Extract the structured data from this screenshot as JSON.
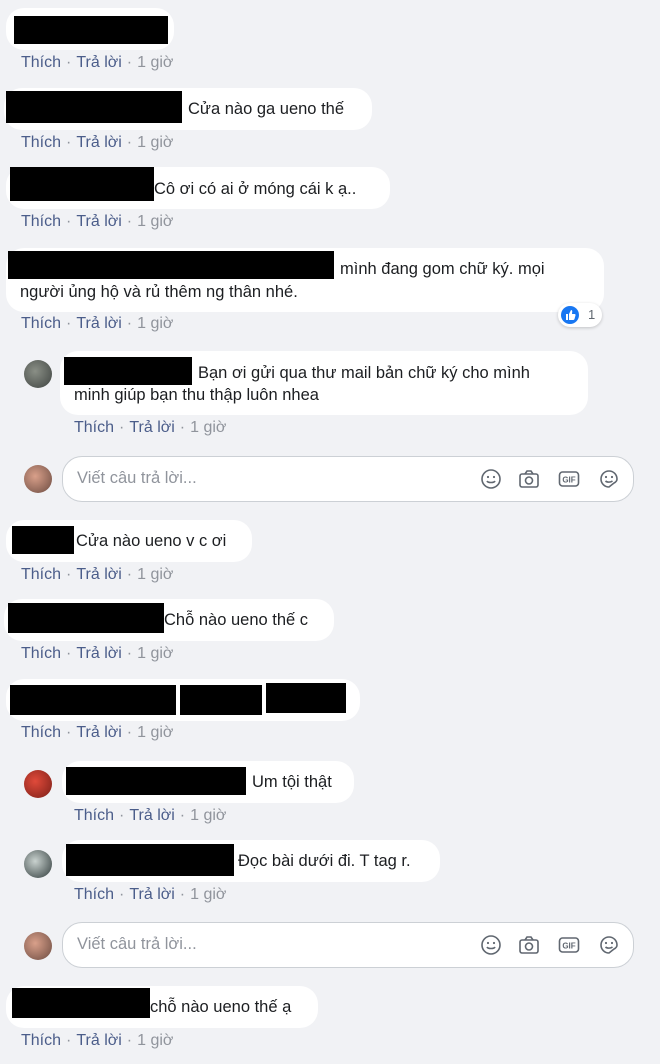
{
  "comments": [
    {
      "text": "",
      "actions": {
        "like": "Thích",
        "reply": "Trả lời",
        "time": "1 giờ"
      }
    },
    {
      "text": "Cửa nào ga ueno thế",
      "actions": {
        "like": "Thích",
        "reply": "Trả lời",
        "time": "1 giờ"
      }
    },
    {
      "text": "Cô ơi có ai ở móng cái k ạ..",
      "actions": {
        "like": "Thích",
        "reply": "Trả lời",
        "time": "1 giờ"
      }
    },
    {
      "text_line1": "mình đang gom chữ ký. mọi",
      "text_line2": "người ủng hộ và rủ thêm ng thân nhé.",
      "reaction_count": "1",
      "actions": {
        "like": "Thích",
        "reply": "Trả lời",
        "time": "1 giờ"
      }
    },
    {
      "text": "Cửa nào ueno v c ơi",
      "actions": {
        "like": "Thích",
        "reply": "Trả lời",
        "time": "1 giờ"
      }
    },
    {
      "text": "Chỗ nào ueno thế c",
      "actions": {
        "like": "Thích",
        "reply": "Trả lời",
        "time": "1 giờ"
      }
    },
    {
      "text": "",
      "actions": {
        "like": "Thích",
        "reply": "Trả lời",
        "time": "1 giờ"
      }
    },
    {
      "text": "chỗ nào ueno thế ạ",
      "actions": {
        "like": "Thích",
        "reply": "Trả lời",
        "time": "1 giờ"
      }
    }
  ],
  "replies": [
    {
      "text_line1": "Bạn ơi gửi qua thư mail bản chữ ký cho mình",
      "text_line2": "minh giúp bạn thu thập luôn nhea",
      "actions": {
        "like": "Thích",
        "reply": "Trả lời",
        "time": "1 giờ"
      }
    },
    {
      "text": "Um tội thật",
      "actions": {
        "like": "Thích",
        "reply": "Trả lời",
        "time": "1 giờ"
      }
    },
    {
      "text": "Đọc bài dưới đi. T tag r.",
      "actions": {
        "like": "Thích",
        "reply": "Trả lời",
        "time": "1 giờ"
      }
    }
  ],
  "reply_box": {
    "placeholder": "Viết câu trả lời..."
  },
  "icons": {
    "emoji": "emoji-icon",
    "camera": "camera-icon",
    "gif": "gif-icon",
    "sticker": "sticker-icon",
    "like_reaction": "like-reaction-icon"
  },
  "colors": {
    "link": "#4b5d8a",
    "meta": "#90949c",
    "like_blue": "#1877f2"
  }
}
